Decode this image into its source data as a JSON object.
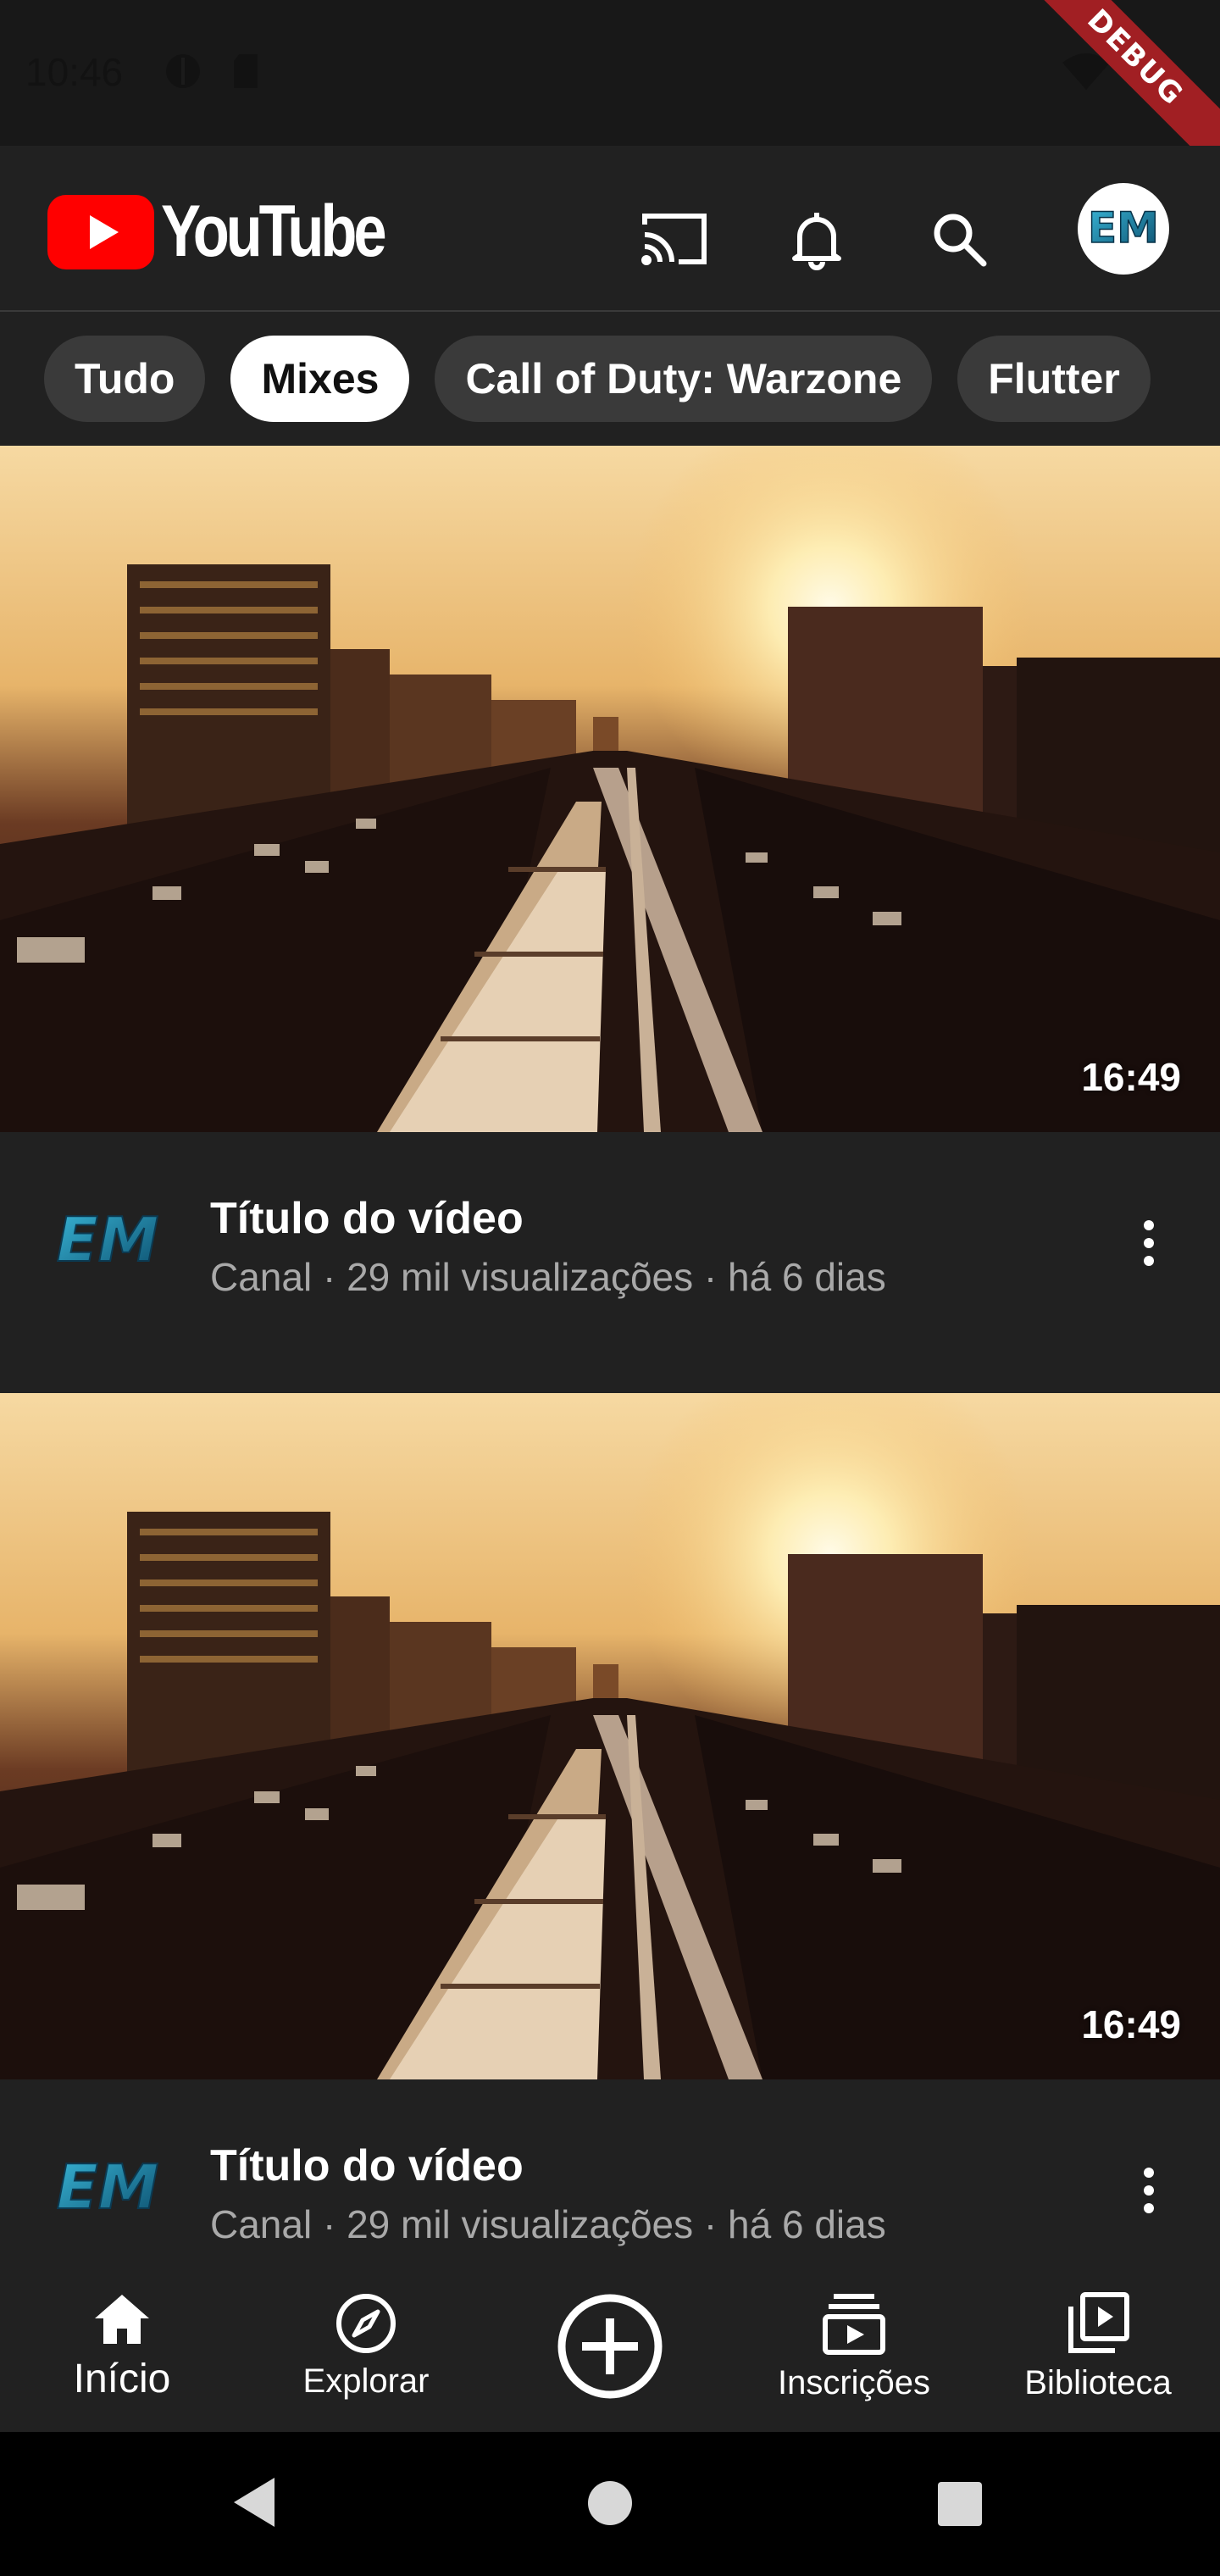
{
  "status": {
    "time": "10:46"
  },
  "debug_banner": "DEBUG",
  "header": {
    "brand": "YouTube",
    "icons": [
      "cast-icon",
      "bell-icon",
      "search-icon"
    ],
    "avatar_text": "EM"
  },
  "chips": [
    "Tudo",
    "Mixes",
    "Call of Duty: Warzone",
    "Flutter"
  ],
  "selected_chip": "Mixes",
  "videos": [
    {
      "title": "Título do vídeo",
      "subtitle": "Canal · 29 mil visualizações · há 6 dias",
      "duration": "16:49"
    },
    {
      "title": "Título do vídeo",
      "subtitle": "Canal · 29 mil visualizações · há 6 dias",
      "duration": "16:49"
    }
  ],
  "bottom_nav": [
    {
      "label": "Início",
      "icon": "home-icon",
      "active": true
    },
    {
      "label": "Explorar",
      "icon": "compass-icon",
      "active": false
    },
    {
      "label": "",
      "icon": "add-circle-icon",
      "active": false
    },
    {
      "label": "Inscrições",
      "icon": "subscriptions-icon",
      "active": false
    },
    {
      "label": "Biblioteca",
      "icon": "library-icon",
      "active": false
    }
  ],
  "colors": {
    "background": "#212121",
    "chip": "#3a3a3a",
    "brand_red": "#ff0000",
    "debug_ribbon": "#a11f23"
  }
}
